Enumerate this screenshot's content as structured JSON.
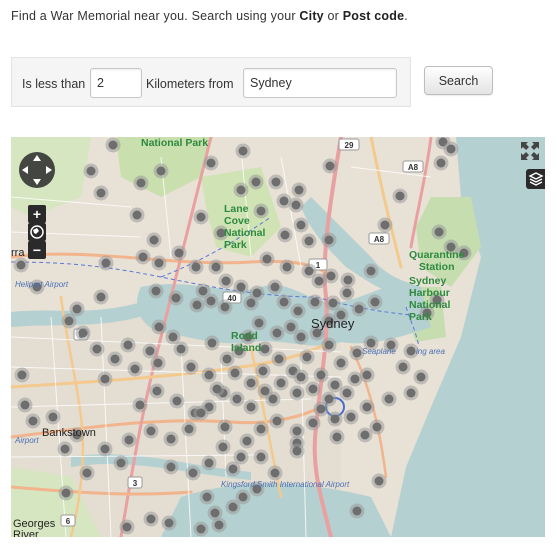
{
  "intro": {
    "prefix": "Find a War Memorial near you. Search using your ",
    "city": "City",
    "or": " or ",
    "postcode": "Post code",
    "suffix": "."
  },
  "search": {
    "less_than_label": "Is less than",
    "distance_value": "2",
    "km_label": "Kilometers from",
    "location_value": "Sydney",
    "button_label": "Search"
  },
  "map": {
    "labels": {
      "national_park": "National\nPark",
      "lane_cove": "Lane\nCove\nNational\nPark",
      "quarantine": "Quarantine\nStation",
      "harbour_np": "Sydney\nHarbour\nNational\nPark",
      "sydney": "Sydney",
      "rodd_island": "Rodd\nIsland",
      "bankstown": "Bankstown",
      "bankstown_airport": "Airport",
      "georges_river": "Georges\nRiver",
      "kingsford": "Kingsford Smith International Airport",
      "seaplane": "Seaplane",
      "landing": "ing area",
      "heliport": "Heliport Airport",
      "arra": "rra"
    },
    "route_shields": [
      "29",
      "A8",
      "A8",
      "1",
      "40",
      "6",
      "3",
      "6"
    ],
    "controls": {
      "pan": "pan-control",
      "zoom_in": "+",
      "zoom_out": "−",
      "fullscreen": "fullscreen-icon",
      "layers": "layers-icon"
    },
    "colors": {
      "land": "#e8e1d6",
      "water": "#b5d0d0",
      "park": "#c8dfae",
      "marker": "#6e6e6e"
    }
  }
}
